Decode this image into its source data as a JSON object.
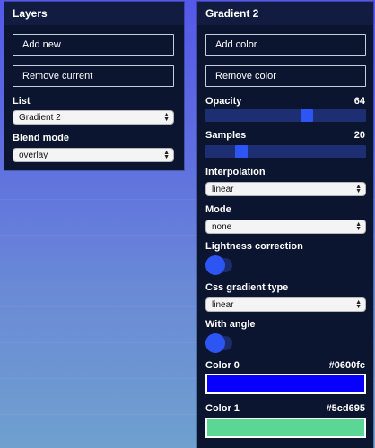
{
  "layers": {
    "title": "Layers",
    "add_new": "Add new",
    "remove_current": "Remove current",
    "list_label": "List",
    "list_value": "Gradient 2",
    "blend_label": "Blend mode",
    "blend_value": "overlay"
  },
  "gradient": {
    "title": "Gradient 2",
    "add_color": "Add color",
    "remove_color": "Remove color",
    "opacity_label": "Opacity",
    "opacity_value": "64",
    "opacity_fraction": 0.64,
    "samples_label": "Samples",
    "samples_value": "20",
    "samples_fraction": 0.2,
    "interpolation_label": "Interpolation",
    "interpolation_value": "linear",
    "mode_label": "Mode",
    "mode_value": "none",
    "lightness_label": "Lightness correction",
    "lightness_on": true,
    "css_type_label": "Css gradient type",
    "css_type_value": "linear",
    "angle_label": "With angle",
    "angle_on": true,
    "color0_label": "Color 0",
    "color0_value": "#0600fc",
    "color1_label": "Color 1",
    "color1_value": "#5cd695"
  },
  "colors": {
    "panel_bg": "#0c1530",
    "accent": "#2c55f4",
    "track": "#1d2e72"
  }
}
